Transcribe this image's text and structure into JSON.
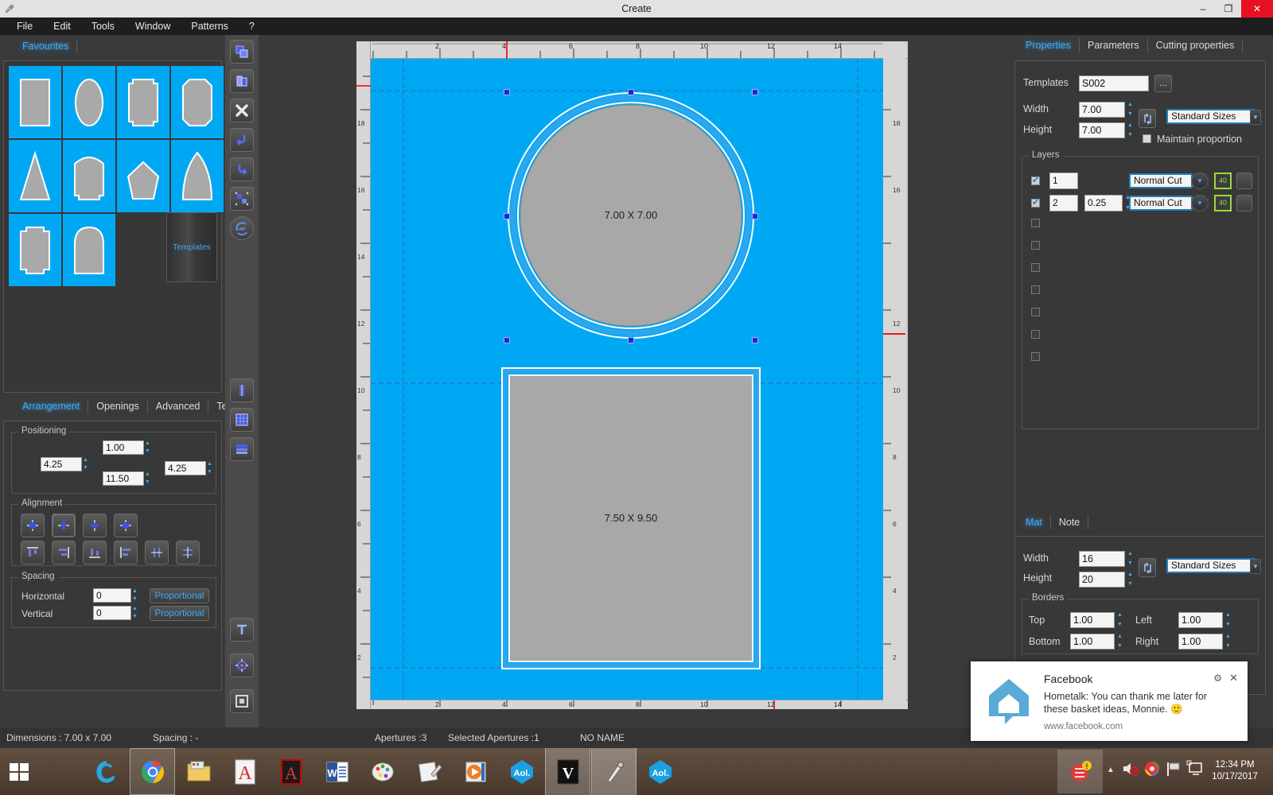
{
  "window": {
    "title": "Create",
    "app_icon": "cutter-icon",
    "minimize": "–",
    "maximize": "❐",
    "close": "✕"
  },
  "menubar": {
    "items": [
      "File",
      "Edit",
      "Tools",
      "Window",
      "Patterns",
      "?"
    ]
  },
  "left_panel": {
    "tabs": [
      {
        "label": "Favourites",
        "active": true
      }
    ],
    "templates_button": "Templates",
    "shapes": [
      "rectangle",
      "oval",
      "notched-rectangle",
      "rounded-rectangle",
      "triangle",
      "arched-top",
      "pentagon",
      "pointed-arch",
      "octagon-notched",
      "dome-arch"
    ]
  },
  "arrangement": {
    "tabs": [
      {
        "label": "Arrangement",
        "active": true
      },
      {
        "label": "Openings",
        "active": false
      },
      {
        "label": "Advanced",
        "active": false
      },
      {
        "label": "Text",
        "active": false
      }
    ],
    "positioning": {
      "label": "Positioning",
      "top": "1.00",
      "bottom": "11.50",
      "left": "4.25",
      "right": "4.25"
    },
    "alignment": {
      "label": "Alignment",
      "buttons": [
        "align-center-vertical",
        "align-middle-horizontal",
        "align-center-cross",
        "align-center-both",
        "distribute-top",
        "distribute-right",
        "distribute-bottom",
        "distribute-left",
        "space-horizontal",
        "space-vertical"
      ]
    },
    "spacing": {
      "label": "Spacing",
      "horizontal_label": "Horizontal",
      "horizontal_value": "0",
      "horizontal_button": "Proportional",
      "vertical_label": "Vertical",
      "vertical_value": "0",
      "vertical_button": "Proportional"
    }
  },
  "toolstrip": {
    "items": [
      "copy-icon",
      "paste-icon",
      "delete-icon",
      "undo-icon",
      "redo-icon",
      "group-icon",
      "rotate-90-icon",
      "measure-icon",
      "grid-icon",
      "layers-icon",
      "text-icon",
      "target-icon",
      "frame-icon"
    ]
  },
  "canvas": {
    "ruler_top_ticks": [
      "2",
      "4",
      "6",
      "8",
      "10",
      "12",
      "14"
    ],
    "ruler_left_ticks": [
      "18",
      "16",
      "14",
      "12",
      "10",
      "8",
      "6",
      "4",
      "2"
    ],
    "ruler_right_ticks": [
      "18",
      "16",
      "12",
      "10",
      "8",
      "6",
      "4",
      "2"
    ],
    "shapes": [
      {
        "name": "circle-aperture",
        "label": "7.00 X 7.00",
        "selected": true
      },
      {
        "name": "rectangle-aperture",
        "label": "7.50 X 9.50",
        "selected": false
      }
    ]
  },
  "properties": {
    "tabs": [
      {
        "label": "Properties",
        "active": true
      },
      {
        "label": "Parameters",
        "active": false
      },
      {
        "label": "Cutting properties",
        "active": false
      }
    ],
    "templates_label": "Templates",
    "templates_value": "S002",
    "browse_button": "...",
    "width_label": "Width",
    "width_value": "7.00",
    "height_label": "Height",
    "height_value": "7.00",
    "swap_button": "swap-icon",
    "standard_sizes": "Standard Sizes",
    "maintain_proportion_label": "Maintain proportion",
    "maintain_proportion_checked": false,
    "layers": {
      "label": "Layers",
      "rows": [
        {
          "checked": true,
          "index": "1",
          "offset": "",
          "cut": "Normal Cut",
          "angle": "40"
        },
        {
          "checked": true,
          "index": "2",
          "offset": "0.25",
          "cut": "Normal Cut",
          "angle": "40"
        },
        {
          "checked": false,
          "index": "",
          "offset": "",
          "cut": "",
          "angle": ""
        },
        {
          "checked": false,
          "index": "",
          "offset": "",
          "cut": "",
          "angle": ""
        },
        {
          "checked": false,
          "index": "",
          "offset": "",
          "cut": "",
          "angle": ""
        },
        {
          "checked": false,
          "index": "",
          "offset": "",
          "cut": "",
          "angle": ""
        },
        {
          "checked": false,
          "index": "",
          "offset": "",
          "cut": "",
          "angle": ""
        },
        {
          "checked": false,
          "index": "",
          "offset": "",
          "cut": "",
          "angle": ""
        },
        {
          "checked": false,
          "index": "",
          "offset": "",
          "cut": "",
          "angle": ""
        }
      ]
    }
  },
  "mat": {
    "tabs": [
      {
        "label": "Mat",
        "active": true
      },
      {
        "label": "Note",
        "active": false
      }
    ],
    "width_label": "Width",
    "width_value": "16",
    "height_label": "Height",
    "height_value": "20",
    "standard_sizes": "Standard Sizes",
    "borders": {
      "label": "Borders",
      "top_label": "Top",
      "top_value": "1.00",
      "left_label": "Left",
      "left_value": "1.00",
      "bottom_label": "Bottom",
      "bottom_value": "1.00",
      "right_label": "Right",
      "right_value": "1.00"
    }
  },
  "statusbar": {
    "dimensions": "Dimensions : 7.00 x 7.00",
    "spacing": "Spacing :  -",
    "apertures": "Apertures :3",
    "selected_apertures": "Selected Apertures :1",
    "name": "NO NAME"
  },
  "notification": {
    "icon": "hometalk-house-icon",
    "title": "Facebook",
    "body": "Hometalk: You can thank me later for these basket ideas, Monnie. 🙂",
    "url": "www.facebook.com",
    "settings_icon": "gear-icon",
    "close_icon": "close-icon"
  },
  "taskbar": {
    "start": "windows-start-icon",
    "items": [
      "internet-explorer-icon",
      "google-chrome-icon",
      "file-explorer-icon",
      "adobe-reader-icon",
      "adobe-acrobat-icon",
      "word-icon",
      "paint-icon",
      "notes-icon",
      "media-player-icon",
      "aol-icon",
      "vegas-icon",
      "create-app-icon",
      "aol-desktop-icon"
    ],
    "tray": [
      "alert-icon",
      "show-hidden-icon",
      "volume-muted-icon",
      "network-icon",
      "flag-icon",
      "display-icon"
    ],
    "time": "12:34 PM",
    "date": "10/17/2017"
  },
  "colors": {
    "accent": "#3fa9f5",
    "canvas_mat": "#00a8f3",
    "aperture_fill": "#a8a8a8",
    "panel": "#3a3a3a",
    "titlebar": "#e2e2e2",
    "close": "#e81123"
  }
}
